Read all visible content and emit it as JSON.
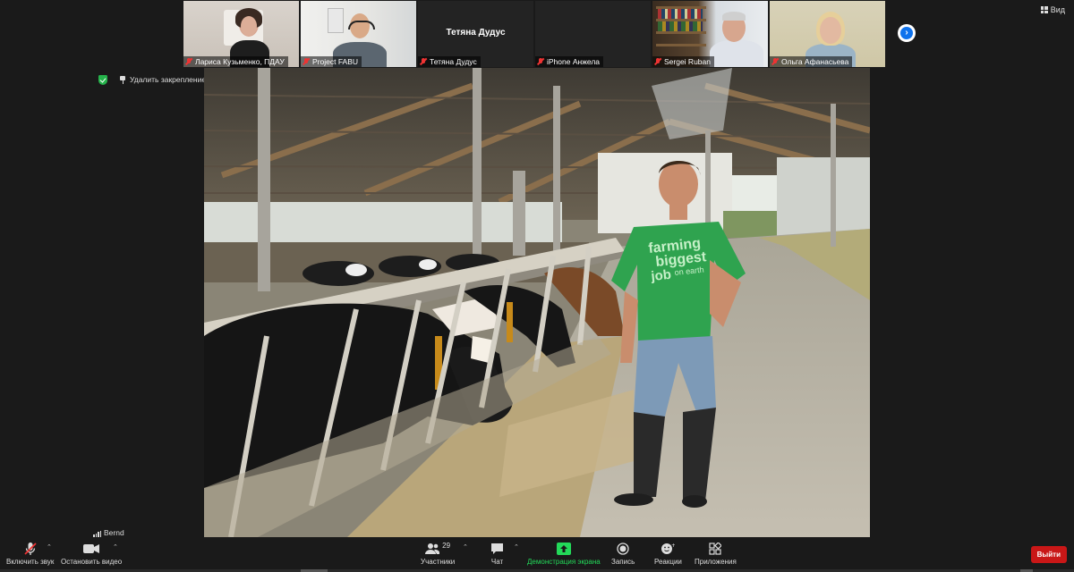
{
  "window": {
    "view_label": "Вид"
  },
  "participants": [
    {
      "name": "Лариса Кузьменко, ПДАУ",
      "muted": true,
      "video": true
    },
    {
      "name": "Project FABU",
      "muted": true,
      "video": true
    },
    {
      "name": "Тетяна Дудус",
      "muted": true,
      "video": false,
      "display_name": "Тетяна Дудус"
    },
    {
      "name": "iPhone Анжела",
      "muted": true,
      "video": false
    },
    {
      "name": "Sergei Ruban",
      "muted": true,
      "video": true
    },
    {
      "name": "Ольга Афанасьева",
      "muted": true,
      "video": true
    }
  ],
  "pin": {
    "label": "Удалить закрепление"
  },
  "active_speaker": {
    "name": "Bernd"
  },
  "shirt_text": {
    "line1": "farming",
    "line2": "biggest",
    "line3": "job",
    "line4": "on earth"
  },
  "toolbar": {
    "audio_label": "Включить звук",
    "video_label": "Остановить видео",
    "participants_label": "Участники",
    "participants_count": "29",
    "chat_label": "Чат",
    "share_label": "Демонстрация экрана",
    "record_label": "Запись",
    "reactions_label": "Реакции",
    "apps_label": "Приложения",
    "exit_label": "Выйти"
  },
  "colors": {
    "accent": "#0e72ed",
    "share_green": "#23d959",
    "exit_red": "#c91717",
    "muted_red": "#e33333"
  }
}
